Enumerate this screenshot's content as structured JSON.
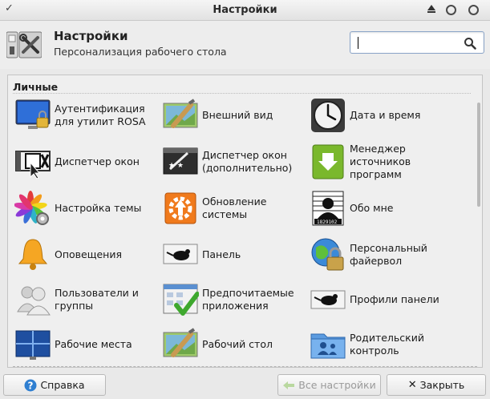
{
  "window": {
    "title": "Настройки"
  },
  "header": {
    "title": "Настройки",
    "subtitle": "Персонализация рабочего стола",
    "search": {
      "value": "",
      "placeholder": ""
    }
  },
  "category": {
    "name": "Личные"
  },
  "items": [
    {
      "label": "Аутентификация\nдля утилит ROSA",
      "icon": "monitor-lock-icon"
    },
    {
      "label": "Внешний вид",
      "icon": "paint-brush-icon"
    },
    {
      "label": "Дата и время",
      "icon": "clock-icon"
    },
    {
      "label": "Диспетчер окон",
      "icon": "window-x-icon"
    },
    {
      "label": "Диспетчер окон\n(дополнительно)",
      "icon": "window-magic-icon"
    },
    {
      "label": "Менеджер\nисточников\nпрограмм",
      "icon": "download-arrow-icon"
    },
    {
      "label": "Настройка темы",
      "icon": "color-petals-icon"
    },
    {
      "label": "Обновление\nсистемы",
      "icon": "update-gear-icon"
    },
    {
      "label": "Обо мне",
      "icon": "person-id-icon"
    },
    {
      "label": "Оповещения",
      "icon": "bell-icon"
    },
    {
      "label": "Панель",
      "icon": "mouse-panel-icon"
    },
    {
      "label": "Персональный\nфайервол",
      "icon": "globe-lock-icon"
    },
    {
      "label": "Пользователи и\nгруппы",
      "icon": "users-icon"
    },
    {
      "label": "Предпочитаемые\nприложения",
      "icon": "apps-check-icon"
    },
    {
      "label": "Профили панели",
      "icon": "mouse-profile-icon"
    },
    {
      "label": "Рабочие места",
      "icon": "workspaces-icon"
    },
    {
      "label": "Рабочий стол",
      "icon": "desktop-brush-icon"
    },
    {
      "label": "Родительский\nконтроль",
      "icon": "parental-folder-icon"
    }
  ],
  "footer": {
    "help_label": "Справка",
    "all_settings_label": "Все настройки",
    "close_label": "Закрыть"
  },
  "colors": {
    "accent": "#2f7fd1",
    "search_border": "#8aa4c8"
  }
}
